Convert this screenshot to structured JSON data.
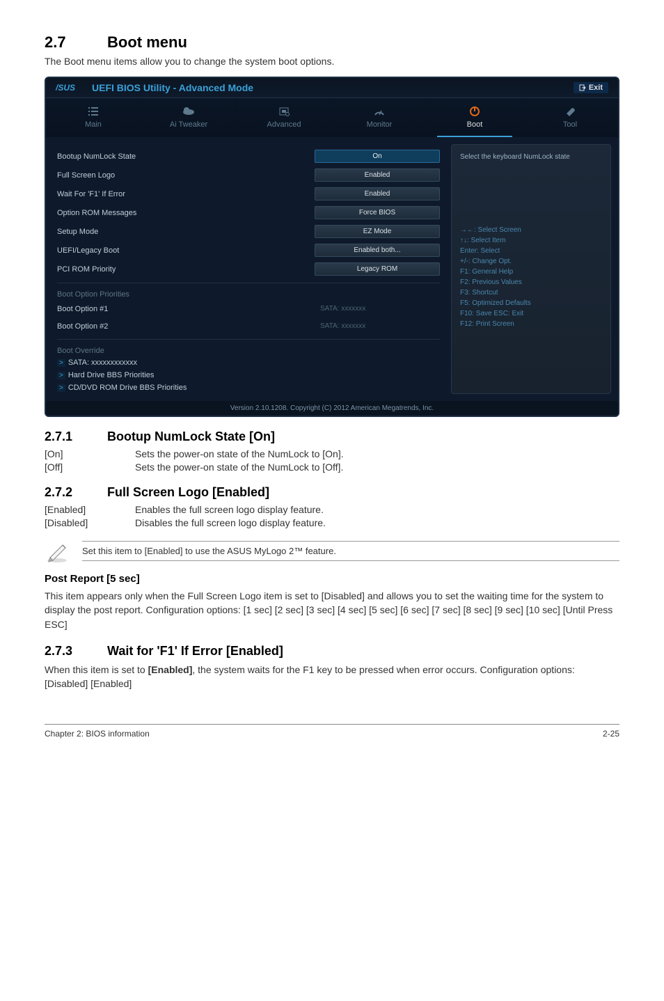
{
  "section27": {
    "num": "2.7",
    "title": "Boot menu",
    "intro": "The Boot menu items allow you to change the system boot options."
  },
  "bios": {
    "brand": "UEFI BIOS Utility - Advanced Mode",
    "exit": "Exit",
    "tabs": {
      "main": "Main",
      "tweaker": "Ai Tweaker",
      "advanced": "Advanced",
      "monitor": "Monitor",
      "boot": "Boot",
      "tool": "Tool"
    },
    "rows": {
      "numlock": {
        "label": "Bootup NumLock State",
        "value": "On"
      },
      "logo": {
        "label": "Full Screen Logo",
        "value": "Enabled"
      },
      "waitf1": {
        "label": "Wait For 'F1' If Error",
        "value": "Enabled"
      },
      "optrom": {
        "label": "Option ROM Messages",
        "value": "Force BIOS"
      },
      "setupmode": {
        "label": "Setup Mode",
        "value": "EZ Mode"
      },
      "uefi": {
        "label": "UEFI/Legacy Boot",
        "value": "Enabled both..."
      },
      "pcirom": {
        "label": "PCI ROM Priority",
        "value": "Legacy ROM"
      }
    },
    "bootprio": {
      "header": "Boot Option Priorities",
      "opt1": {
        "label": "Boot Option #1",
        "value": "SATA: xxxxxxx"
      },
      "opt2": {
        "label": "Boot Option #2",
        "value": "SATA: xxxxxxx"
      }
    },
    "override": {
      "header": "Boot Override",
      "sata": "SATA: xxxxxxxxxxxx",
      "hdd": "Hard Drive BBS Priorities",
      "cddvd": "CD/DVD ROM Drive BBS Priorities"
    },
    "help": {
      "top": "Select the keyboard NumLock state",
      "k1": "→←: Select Screen",
      "k2": "↑↓: Select Item",
      "k3": "Enter: Select",
      "k4": "+/-: Change Opt.",
      "k5": "F1: General Help",
      "k6": "F2: Previous Values",
      "k7": "F3: Shortcut",
      "k8": "F5: Optimized Defaults",
      "k9": "F10: Save   ESC: Exit",
      "k10": "F12: Print Screen"
    },
    "footer": "Version 2.10.1208. Copyright (C) 2012 American Megatrends, Inc."
  },
  "s271": {
    "num": "2.7.1",
    "title": "Bootup NumLock State [On]",
    "on": {
      "k": "[On]",
      "v": "Sets the power-on state of the NumLock to [On]."
    },
    "off": {
      "k": "[Off]",
      "v": "Sets the power-on state of the NumLock to [Off]."
    }
  },
  "s272": {
    "num": "2.7.2",
    "title": "Full Screen Logo [Enabled]",
    "en": {
      "k": "[Enabled]",
      "v": "Enables the full screen logo display feature."
    },
    "dis": {
      "k": "[Disabled]",
      "v": "Disables the full screen logo display feature."
    },
    "note": "Set this item to [Enabled] to use the ASUS MyLogo 2™ feature."
  },
  "postreport": {
    "title": "Post Report [5 sec]",
    "body": "This item appears only when the Full Screen Logo item is set to [Disabled] and allows you to set the waiting time for the system to display the post report. Configuration options: [1 sec] [2 sec] [3 sec] [4 sec] [5 sec] [6 sec] [7 sec] [8 sec] [9 sec] [10 sec] [Until Press ESC]"
  },
  "s273": {
    "num": "2.7.3",
    "title": "Wait for 'F1' If Error [Enabled]",
    "body": "When this item is set to [Enabled], the system waits for the F1 key to be pressed when error occurs. Configuration options: [Disabled] [Enabled]"
  },
  "footer": {
    "left": "Chapter 2: BIOS information",
    "right": "2-25"
  },
  "chart_data": {
    "type": "table",
    "note": "no chart present"
  }
}
